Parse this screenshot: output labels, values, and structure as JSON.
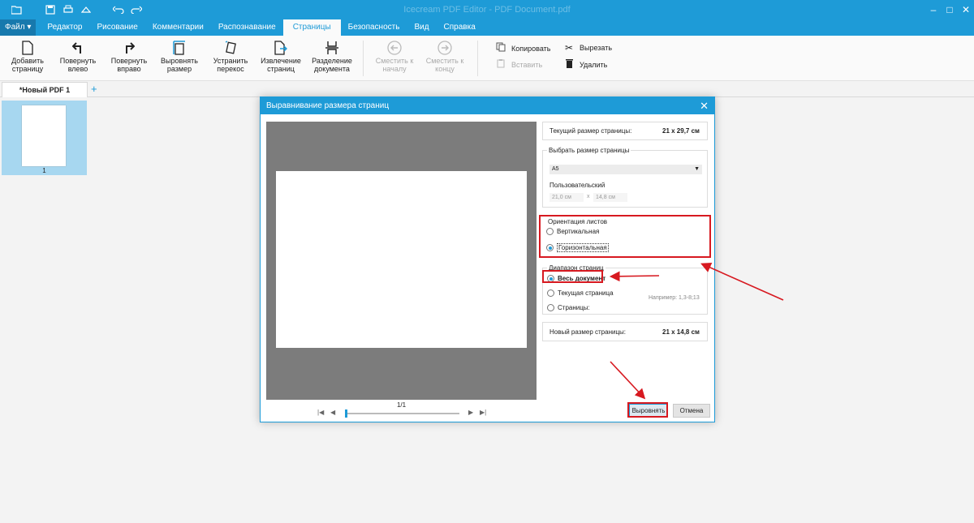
{
  "titlebar": {
    "title": "Icecream PDF Editor - PDF Document.pdf",
    "icons": [
      "folder-open-icon",
      "save-icon",
      "print-icon",
      "clear-icon",
      "undo-icon",
      "redo-icon"
    ]
  },
  "menu": {
    "file": "Файл",
    "items": [
      "Редактор",
      "Рисование",
      "Комментарии",
      "Распознавание",
      "Страницы",
      "Безопасность",
      "Вид",
      "Справка"
    ],
    "active": "Страницы"
  },
  "ribbon": {
    "buttons": [
      {
        "line1": "Добавить",
        "line2": "страницу",
        "icon": "add-page-icon"
      },
      {
        "line1": "Повернуть",
        "line2": "влево",
        "icon": "rotate-left-icon"
      },
      {
        "line1": "Повернуть",
        "line2": "вправо",
        "icon": "rotate-right-icon"
      },
      {
        "line1": "Выровнять",
        "line2": "размер",
        "icon": "align-size-icon"
      },
      {
        "line1": "Устранить",
        "line2": "перекос",
        "icon": "deskew-icon"
      },
      {
        "line1": "Извлечение",
        "line2": "страниц",
        "icon": "extract-pages-icon"
      },
      {
        "line1": "Разделение",
        "line2": "документа",
        "icon": "split-document-icon"
      },
      {
        "line1": "Сместить к",
        "line2": "началу",
        "icon": "move-to-start-icon"
      },
      {
        "line1": "Сместить к",
        "line2": "концу",
        "icon": "move-to-end-icon"
      }
    ],
    "copy": "Копировать",
    "paste": "Вставить",
    "cut": "Вырезать",
    "delete": "Удалить"
  },
  "tabs": {
    "doc": "*Новый PDF 1",
    "add": "+"
  },
  "thumbnails": {
    "page_number": "1"
  },
  "dialog": {
    "title": "Выравнивание размера страниц",
    "current_size_label": "Текущий размер страницы:",
    "current_size_value": "21 x 29,7 см",
    "choose_size_label": "Выбрать размер страницы",
    "selected_size": "A5",
    "custom_label": "Пользовательский",
    "custom_width": "21,0 см",
    "custom_x": "x",
    "custom_height": "14,8 см",
    "orientation_label": "Ориентация листов",
    "orientation_vertical": "Вертикальная",
    "orientation_horizontal": "Горизонтальная",
    "orientation_selected": "Горизонтальная",
    "range_label": "Диапазон страниц",
    "range_all": "Весь документ",
    "range_current": "Текущая страница",
    "range_pages": "Страницы:",
    "range_example": "Например: 1,3-8;13",
    "range_selected": "Весь документ",
    "new_size_label": "Новый размер страницы:",
    "new_size_value": "21 x 14,8 см",
    "pager": "1/1",
    "align_button": "Выровнять",
    "cancel_button": "Отмена"
  },
  "colors": {
    "accent": "#1e9bd7",
    "highlight": "#d71920",
    "thumbnail_selected": "#a7d7f0",
    "preview_bg": "#7c7c7c"
  }
}
